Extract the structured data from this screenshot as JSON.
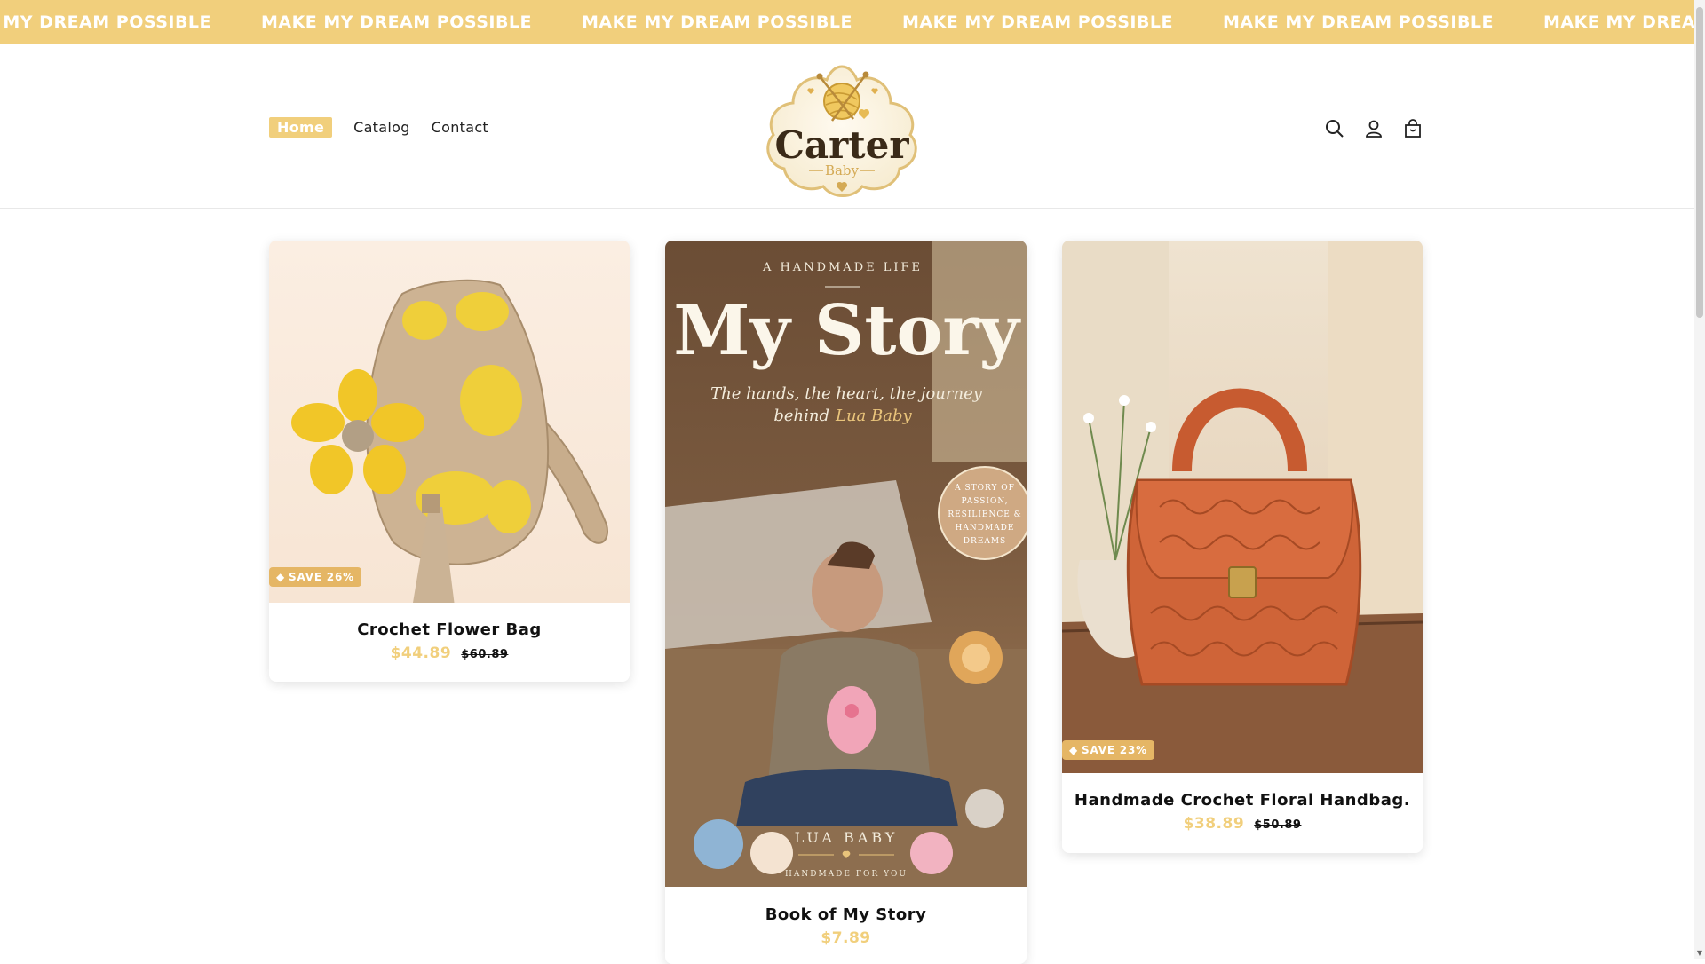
{
  "announcement": {
    "text": "MAKE MY DREAM POSSIBLE",
    "background": "#f1cf7c",
    "repeat": [
      "MAKE MY DREAM POSSIBLE",
      "MAKE MY DREAM POSSIBLE",
      "MAKE MY DREAM POSSIBLE",
      "MAKE MY DREAM POSSIBLE",
      "MAKE MY DREAM POSSIBLE",
      "MAKE MY DREAM POSSIBLE"
    ]
  },
  "header": {
    "nav": [
      {
        "label": "Home",
        "active": true
      },
      {
        "label": "Catalog",
        "active": false
      },
      {
        "label": "Contact",
        "active": false
      }
    ],
    "logo": {
      "text": "Carter",
      "subtext": "Baby"
    },
    "icons": [
      "search-icon",
      "account-icon",
      "cart-icon"
    ]
  },
  "products": [
    {
      "title": "Crochet Flower Bag",
      "price": "$44.89",
      "compare": "$60.89",
      "badge": "SAVE 26%"
    },
    {
      "title": "Book of My Story",
      "price": "$7.89",
      "compare": "",
      "badge": "",
      "cover": {
        "overline": "A HANDMADE LIFE",
        "title": "My Story",
        "subtitle": "The hands, the heart, the journey",
        "subtitle2": "behind",
        "subtitle_name": "Lua Baby",
        "seal": [
          "A STORY OF",
          "PASSION,",
          "RESILIENCE &",
          "HANDMADE",
          "DREAMS"
        ],
        "author": "LUA BABY",
        "footer": "HANDMADE FOR YOU"
      }
    },
    {
      "title": "Handmade Crochet Floral Handbag.",
      "price": "$38.89",
      "compare": "$50.89",
      "badge": "SAVE 23%"
    }
  ],
  "colors": {
    "accent": "#f1cf7c",
    "badge": "#e5b665"
  }
}
